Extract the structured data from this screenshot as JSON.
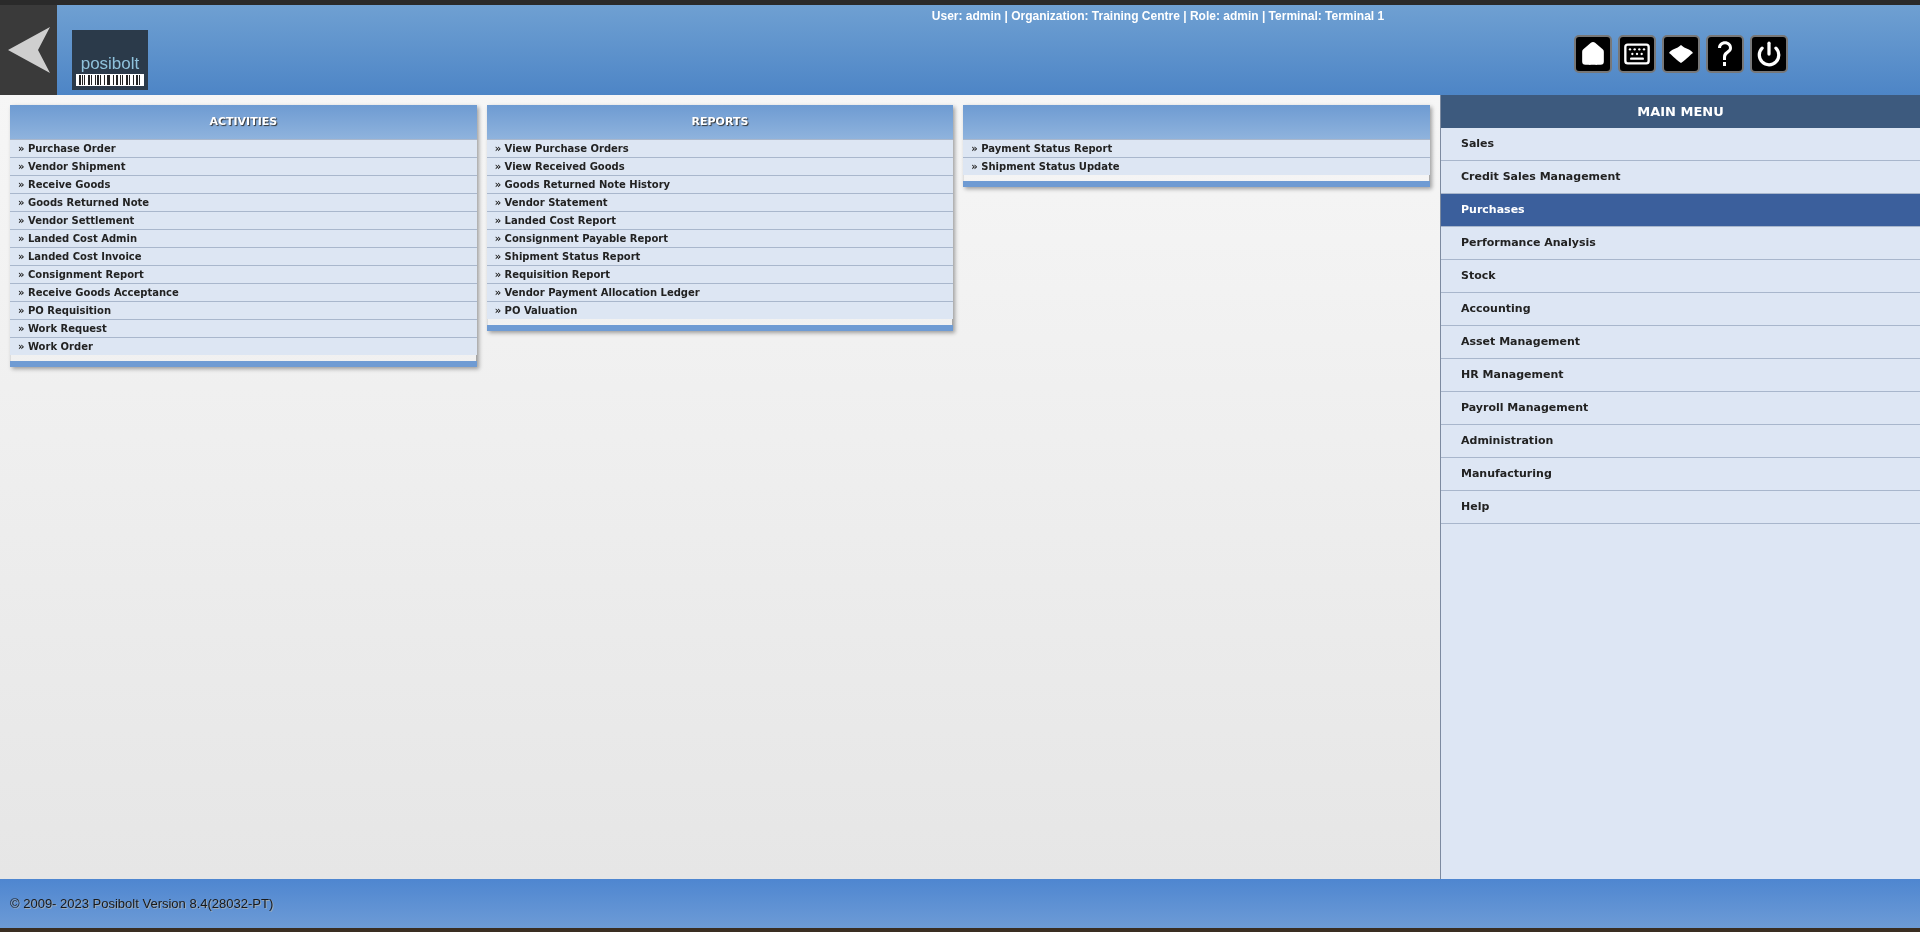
{
  "header": {
    "logo_text": "posibolt",
    "user_info": "User: admin | Organization: Training Centre | Role: admin | Terminal: Terminal 1"
  },
  "panels": [
    {
      "title": "ACTIVITIES",
      "items": [
        "» Purchase Order",
        "» Vendor Shipment",
        "» Receive Goods",
        "» Goods Returned Note",
        "» Vendor Settlement",
        "» Landed Cost Admin",
        "» Landed Cost Invoice",
        "» Consignment Report",
        "» Receive Goods Acceptance",
        "» PO Requisition",
        "» Work Request",
        "» Work Order"
      ]
    },
    {
      "title": "REPORTS",
      "items": [
        "» View Purchase Orders",
        "» View Received Goods",
        "» Goods Returned Note History",
        "» Vendor Statement",
        "» Landed Cost Report",
        "» Consignment Payable Report",
        "» Shipment Status Report",
        "» Requisition Report",
        "» Vendor Payment Allocation Ledger",
        "» PO Valuation"
      ]
    },
    {
      "items": [
        "» Payment Status Report",
        "» Shipment Status Update"
      ]
    }
  ],
  "main_menu": {
    "title": "MAIN MENU",
    "items": [
      {
        "label": "Sales",
        "selected": false
      },
      {
        "label": "Credit Sales Management",
        "selected": false
      },
      {
        "label": "Purchases",
        "selected": true
      },
      {
        "label": "Performance Analysis",
        "selected": false
      },
      {
        "label": "Stock",
        "selected": false
      },
      {
        "label": "Accounting",
        "selected": false
      },
      {
        "label": "Asset Management",
        "selected": false
      },
      {
        "label": "HR Management",
        "selected": false
      },
      {
        "label": "Payroll Management",
        "selected": false
      },
      {
        "label": "Administration",
        "selected": false
      },
      {
        "label": "Manufacturing",
        "selected": false
      },
      {
        "label": "Help",
        "selected": false
      }
    ]
  },
  "footer": {
    "text": "© 2009- 2023 Posibolt Version  8.4(28032-PT)"
  }
}
